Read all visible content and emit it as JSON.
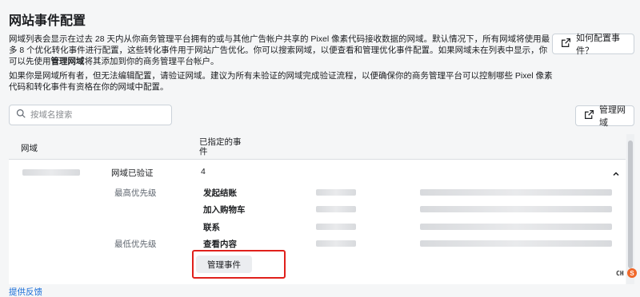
{
  "header": {
    "title": "网站事件配置"
  },
  "description": {
    "para1_before": "网域列表会显示在过去 28 天内从你商务管理平台拥有的或与其他广告帐户共享的 Pixel 像素代码接收数据的网域。默认情况下，所有网域将使用最多 8 个优化转化事件进行配置，这些转化事件用于网站广告优化。你可以搜索网域，以便查看和管理优化事件配置。如果网域未在列表中显示，你可以先使用",
    "para1_bold": "管理网域",
    "para1_after": "将其添加到你的商务管理平台帐户。",
    "para2": "如果你是网域所有者，但无法编辑配置，请验证网域。建议为所有未验证的网域完成验证流程，以便确保你的商务管理平台可以控制哪些 Pixel 像素代码和转化事件有资格在你的网域中配置。"
  },
  "buttons": {
    "how_to_config": "如何配置事件？",
    "manage_domains": "管理网域",
    "manage_events": "管理事件"
  },
  "search": {
    "placeholder": "按域名搜索"
  },
  "table": {
    "col_domain": "网域",
    "col_events_line1": "已指定的事",
    "col_events_line2": "件",
    "row": {
      "status": "网域已验证",
      "event_count": "4",
      "highest_priority": "最高优先级",
      "lowest_priority": "最低优先级",
      "events": [
        "发起结账",
        "加入购物车",
        "联系",
        "查看内容"
      ]
    }
  },
  "footer": {
    "feedback": "提供反馈"
  },
  "system": {
    "ime_label": "CH",
    "ime_icon_letter": "S"
  },
  "colors": {
    "accent_link": "#1a6ed8",
    "highlight": "#e0201b"
  }
}
